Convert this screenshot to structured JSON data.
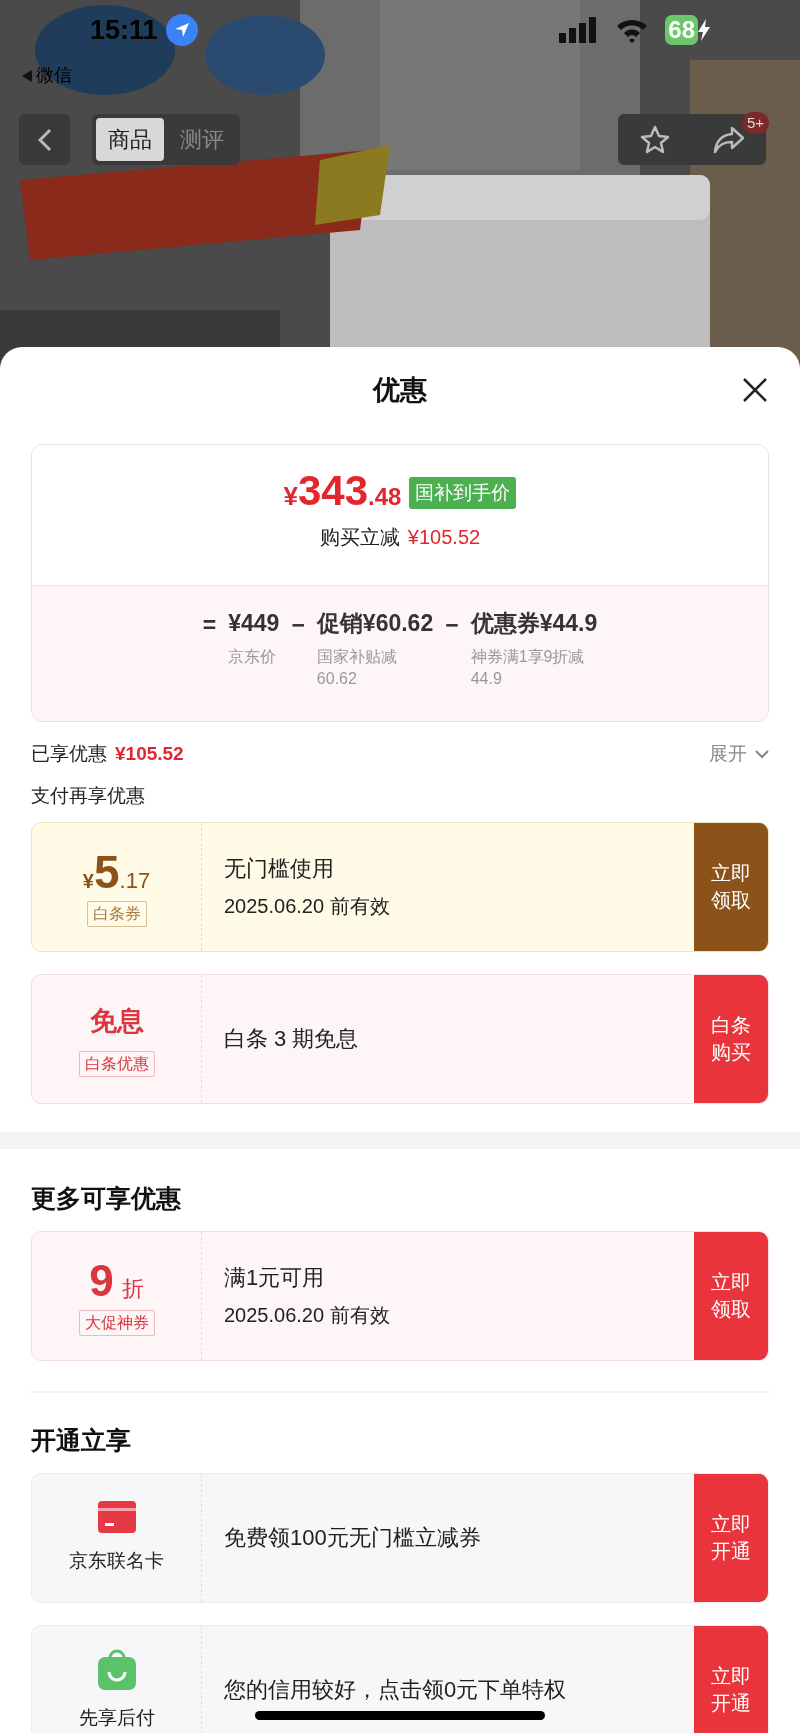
{
  "status_bar": {
    "time": "15:11",
    "back_app": "微信",
    "battery": "68"
  },
  "nav": {
    "tabs": [
      {
        "label": "商品",
        "selected": true
      },
      {
        "label": "测评",
        "selected": false
      }
    ],
    "badge": "5+"
  },
  "sheet": {
    "title": "优惠",
    "summary": {
      "currency": "¥",
      "price_major": "343",
      "price_minor": ".48",
      "price_tag": "国补到手价",
      "saving_label": "购买立减",
      "saving_value": "¥105.52",
      "breakdown": [
        {
          "op": "=",
          "value": "¥449",
          "note_lines": [
            "京东价"
          ]
        },
        {
          "op": "−",
          "value": "促销¥60.62",
          "note_lines": [
            "国家补贴减",
            "60.62"
          ]
        },
        {
          "op": "−",
          "value": "优惠券¥44.9",
          "note_lines": [
            "神券满1享9折减",
            "44.9"
          ]
        }
      ]
    },
    "enjoyed": {
      "label": "已享优惠",
      "value": "¥105.52",
      "expand": "展开"
    },
    "sections": [
      {
        "title": "支付再享优惠",
        "offers": [
          {
            "kind": "amount",
            "color": "#8b5219",
            "currency": "¥",
            "major": "5",
            "minor": ".17",
            "tag": "白条券",
            "title": "无门槛使用",
            "subtitle": "2025.06.20 前有效",
            "action": "立即领取"
          },
          {
            "kind": "text",
            "color": "#e8343a",
            "major": "免息",
            "tag": "白条优惠",
            "title": "白条 3 期免息",
            "action": "白条购买"
          }
        ]
      },
      {
        "title": "更多可享优惠",
        "offers": [
          {
            "kind": "discount",
            "color": "#e8343a",
            "major": "9",
            "minor": "折",
            "tag": "大促神券",
            "title": "满1元可用",
            "subtitle": "2025.06.20 前有效",
            "action": "立即领取"
          }
        ]
      },
      {
        "title": "开通立享",
        "offers": [
          {
            "kind": "card",
            "color": "#e8343a",
            "label": "京东联名卡",
            "title": "免费领100元无门槛立减券",
            "action": "立即开通"
          },
          {
            "kind": "bag",
            "color": "#e8343a",
            "label": "先享后付",
            "title": "您的信用较好，点击领0元下单特权",
            "action": "立即开通"
          }
        ]
      }
    ]
  }
}
